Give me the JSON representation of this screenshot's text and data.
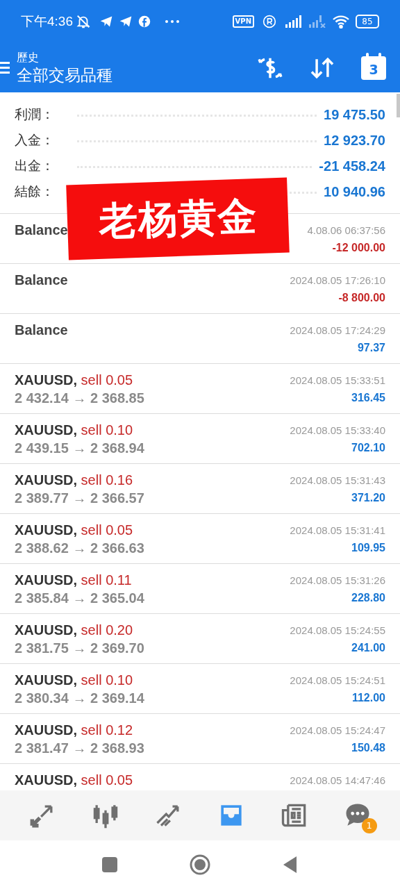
{
  "status_bar": {
    "time": "下午4:36",
    "vpn": "VPN",
    "battery": "85"
  },
  "header": {
    "subtitle": "歷史",
    "title": "全部交易品種",
    "calendar_day": "3"
  },
  "summary": [
    {
      "label": "利潤：",
      "value": "19 475.50"
    },
    {
      "label": "入金：",
      "value": "12 923.70"
    },
    {
      "label": "出金：",
      "value": "-21 458.24"
    },
    {
      "label": "結餘：",
      "value": "10 940.96"
    }
  ],
  "overlay_banner": "老杨黄金",
  "deals": [
    {
      "kind": "balance",
      "symbol": "Balance",
      "time": "4.08.06 06:37:56",
      "profit": "-12 000.00",
      "loss": true
    },
    {
      "kind": "balance",
      "symbol": "Balance",
      "time": "2024.08.05 17:26:10",
      "profit": "-8 800.00",
      "loss": true
    },
    {
      "kind": "balance",
      "symbol": "Balance",
      "time": "2024.08.05 17:24:29",
      "profit": "97.37",
      "loss": false
    },
    {
      "kind": "trade",
      "symbol": "XAUUSD,",
      "side": "sell 0.05",
      "prices": "2 432.14 → 2 368.85",
      "time": "2024.08.05 15:33:51",
      "profit": "316.45",
      "loss": false
    },
    {
      "kind": "trade",
      "symbol": "XAUUSD,",
      "side": "sell 0.10",
      "prices": "2 439.15 → 2 368.94",
      "time": "2024.08.05 15:33:40",
      "profit": "702.10",
      "loss": false
    },
    {
      "kind": "trade",
      "symbol": "XAUUSD,",
      "side": "sell 0.16",
      "prices": "2 389.77 → 2 366.57",
      "time": "2024.08.05 15:31:43",
      "profit": "371.20",
      "loss": false
    },
    {
      "kind": "trade",
      "symbol": "XAUUSD,",
      "side": "sell 0.05",
      "prices": "2 388.62 → 2 366.63",
      "time": "2024.08.05 15:31:41",
      "profit": "109.95",
      "loss": false
    },
    {
      "kind": "trade",
      "symbol": "XAUUSD,",
      "side": "sell 0.11",
      "prices": "2 385.84 → 2 365.04",
      "time": "2024.08.05 15:31:26",
      "profit": "228.80",
      "loss": false
    },
    {
      "kind": "trade",
      "symbol": "XAUUSD,",
      "side": "sell 0.20",
      "prices": "2 381.75 → 2 369.70",
      "time": "2024.08.05 15:24:55",
      "profit": "241.00",
      "loss": false
    },
    {
      "kind": "trade",
      "symbol": "XAUUSD,",
      "side": "sell 0.10",
      "prices": "2 380.34 → 2 369.14",
      "time": "2024.08.05 15:24:51",
      "profit": "112.00",
      "loss": false
    },
    {
      "kind": "trade",
      "symbol": "XAUUSD,",
      "side": "sell 0.12",
      "prices": "2 381.47 → 2 368.93",
      "time": "2024.08.05 15:24:47",
      "profit": "150.48",
      "loss": false
    },
    {
      "kind": "trade",
      "symbol": "XAUUSD,",
      "side": "sell 0.05",
      "time": "2024.08.05 14:47:46"
    }
  ],
  "bottom_nav": [
    {
      "kind": "quotes",
      "selected": false
    },
    {
      "kind": "chart",
      "selected": false
    },
    {
      "kind": "trade",
      "selected": false
    },
    {
      "kind": "history",
      "selected": true
    },
    {
      "kind": "news",
      "selected": false
    },
    {
      "kind": "messages",
      "selected": false,
      "badge": "1"
    }
  ]
}
